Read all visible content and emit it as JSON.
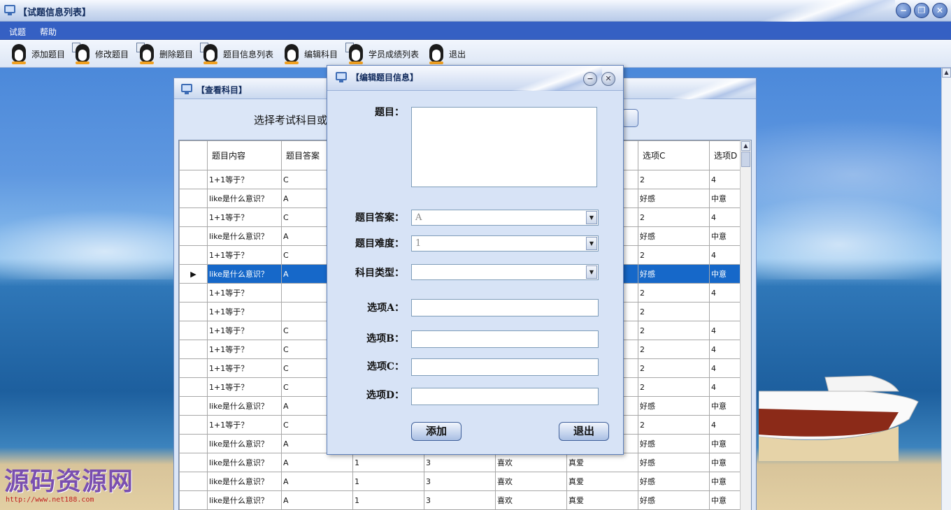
{
  "app": {
    "title": "【试题信息列表】"
  },
  "menu": [
    "试题",
    "帮助"
  ],
  "toolbar": [
    {
      "label": "添加题目",
      "icon": "penguin-add-icon"
    },
    {
      "label": "修改题目",
      "icon": "penguin-edit-icon"
    },
    {
      "label": "删除题目",
      "icon": "penguin-delete-icon"
    },
    {
      "label": "题目信息列表",
      "icon": "penguin-list-icon"
    },
    {
      "label": "编辑科目",
      "icon": "penguin-globe-icon"
    },
    {
      "label": "学员成绩列表",
      "icon": "penguin-score-icon"
    },
    {
      "label": "退出",
      "icon": "penguin-exit-icon"
    }
  ],
  "subject_window": {
    "title": "【查看科目】",
    "hint": "选择考试科目或",
    "columns": [
      "题目内容",
      "题目答案",
      "",
      "",
      "",
      "",
      "选项C",
      "选项D"
    ],
    "rows": [
      [
        "1+1等于？",
        "C",
        "",
        "",
        "",
        "",
        "2",
        "4"
      ],
      [
        "like是什么意识？",
        "A",
        "",
        "",
        "",
        "",
        "好感",
        "中意"
      ],
      [
        "1+1等于？",
        "C",
        "",
        "",
        "",
        "",
        "2",
        "4"
      ],
      [
        "like是什么意识？",
        "A",
        "",
        "",
        "",
        "",
        "好感",
        "中意"
      ],
      [
        "1+1等于？",
        "C",
        "",
        "",
        "",
        "",
        "2",
        "4"
      ],
      [
        "like是什么意识？",
        "A",
        "",
        "",
        "",
        "",
        "好感",
        "中意"
      ],
      [
        "1+1等于？",
        "",
        "",
        "",
        "",
        "",
        "2",
        "4"
      ],
      [
        "1+1等于？",
        "",
        "",
        "",
        "",
        "",
        "2",
        ""
      ],
      [
        "1+1等于？",
        "C",
        "",
        "",
        "",
        "",
        "2",
        "4"
      ],
      [
        "1+1等于？",
        "C",
        "",
        "",
        "",
        "",
        "2",
        "4"
      ],
      [
        "1+1等于？",
        "C",
        "",
        "",
        "",
        "",
        "2",
        "4"
      ],
      [
        "1+1等于？",
        "C",
        "",
        "",
        "",
        "",
        "2",
        "4"
      ],
      [
        "like是什么意识？",
        "A",
        "",
        "",
        "",
        "",
        "好感",
        "中意"
      ],
      [
        "1+1等于？",
        "C",
        "",
        "",
        "",
        "",
        "2",
        "4"
      ],
      [
        "like是什么意识？",
        "A",
        "",
        "",
        "",
        "",
        "好感",
        "中意"
      ],
      [
        "like是什么意识？",
        "A",
        "1",
        "3",
        "喜欢",
        "真爱",
        "好感",
        "中意"
      ],
      [
        "like是什么意识？",
        "A",
        "1",
        "3",
        "喜欢",
        "真爱",
        "好感",
        "中意"
      ],
      [
        "like是什么意识？",
        "A",
        "1",
        "3",
        "喜欢",
        "真爱",
        "好感",
        "中意"
      ]
    ],
    "selected_row": 5
  },
  "dialog": {
    "title": "【编辑题目信息】",
    "question_label": "题目：",
    "question_value": "",
    "answer_label": "题目答案：",
    "answer_value": "A",
    "difficulty_label": "题目难度：",
    "difficulty_value": "1",
    "subject_label": "科目类型：",
    "subject_value": "",
    "optA_label": "选项A：",
    "optB_label": "选项B：",
    "optC_label": "选项C：",
    "optD_label": "选项D：",
    "add_button": "添加",
    "exit_button": "退出"
  },
  "watermark": {
    "text": "源码资源网",
    "url": "http://www.net188.com"
  },
  "colors": {
    "menubar": "#3560c3",
    "selection": "#1668c9",
    "dialog_bg": "#d7e3f6"
  }
}
